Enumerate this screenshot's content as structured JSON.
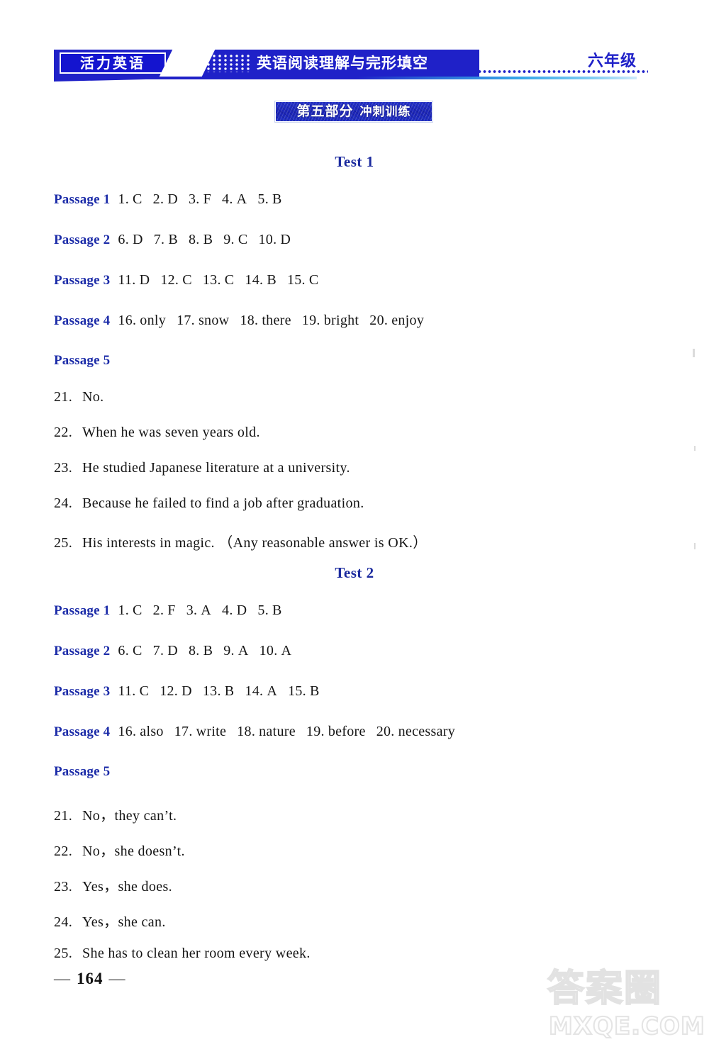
{
  "header": {
    "brand": "活力英语",
    "title": "英语阅读理解与完形填空",
    "grade": "六年级"
  },
  "section": {
    "part_label": "第五部分",
    "part_name": "冲刺训练"
  },
  "footer": {
    "left_dash": "—",
    "page_number": "164",
    "right_dash": "—"
  },
  "watermark": {
    "chinese": "答案圈",
    "domain": "MXQE.COM"
  },
  "tests": [
    {
      "heading": "Test 1",
      "passages": [
        {
          "label": "Passage 1",
          "answers": [
            {
              "num": "1.",
              "val": "C"
            },
            {
              "num": "2.",
              "val": "D"
            },
            {
              "num": "3.",
              "val": "F"
            },
            {
              "num": "4.",
              "val": "A"
            },
            {
              "num": "5.",
              "val": "B"
            }
          ]
        },
        {
          "label": "Passage 2",
          "answers": [
            {
              "num": "6.",
              "val": "D"
            },
            {
              "num": "7.",
              "val": "B"
            },
            {
              "num": "8.",
              "val": "B"
            },
            {
              "num": "9.",
              "val": "C"
            },
            {
              "num": "10.",
              "val": "D"
            }
          ]
        },
        {
          "label": "Passage 3",
          "answers": [
            {
              "num": "11.",
              "val": "D"
            },
            {
              "num": "12.",
              "val": "C"
            },
            {
              "num": "13.",
              "val": "C"
            },
            {
              "num": "14.",
              "val": "B"
            },
            {
              "num": "15.",
              "val": "C"
            }
          ]
        },
        {
          "label": "Passage 4",
          "answers": [
            {
              "num": "16.",
              "val": "only"
            },
            {
              "num": "17.",
              "val": "snow"
            },
            {
              "num": "18.",
              "val": "there"
            },
            {
              "num": "19.",
              "val": "bright"
            },
            {
              "num": "20.",
              "val": "enjoy"
            }
          ]
        },
        {
          "label": "Passage 5",
          "answers": [],
          "qa": [
            {
              "num": "21.",
              "text": "No."
            },
            {
              "num": "22.",
              "text": "When he was seven years old."
            },
            {
              "num": "23.",
              "text": "He studied Japanese literature at a university."
            },
            {
              "num": "24.",
              "text": "Because he failed to find a job after graduation."
            },
            {
              "num": "25.",
              "text": "His interests in magic. （Any reasonable answer is OK.）"
            }
          ]
        }
      ]
    },
    {
      "heading": "Test 2",
      "passages": [
        {
          "label": "Passage 1",
          "answers": [
            {
              "num": "1.",
              "val": "C"
            },
            {
              "num": "2.",
              "val": "F"
            },
            {
              "num": "3.",
              "val": "A"
            },
            {
              "num": "4.",
              "val": "D"
            },
            {
              "num": "5.",
              "val": "B"
            }
          ]
        },
        {
          "label": "Passage 2",
          "answers": [
            {
              "num": "6.",
              "val": "C"
            },
            {
              "num": "7.",
              "val": "D"
            },
            {
              "num": "8.",
              "val": "B"
            },
            {
              "num": "9.",
              "val": "A"
            },
            {
              "num": "10.",
              "val": "A"
            }
          ]
        },
        {
          "label": "Passage 3",
          "answers": [
            {
              "num": "11.",
              "val": "C"
            },
            {
              "num": "12.",
              "val": "D"
            },
            {
              "num": "13.",
              "val": "B"
            },
            {
              "num": "14.",
              "val": "A"
            },
            {
              "num": "15.",
              "val": "B"
            }
          ]
        },
        {
          "label": "Passage 4",
          "answers": [
            {
              "num": "16.",
              "val": "also"
            },
            {
              "num": "17.",
              "val": "write"
            },
            {
              "num": "18.",
              "val": "nature"
            },
            {
              "num": "19.",
              "val": "before"
            },
            {
              "num": "20.",
              "val": "necessary"
            }
          ]
        },
        {
          "label": "Passage 5",
          "answers": [],
          "qa": [
            {
              "num": "21.",
              "text": "No，they can’t."
            },
            {
              "num": "22.",
              "text": "No，she doesn’t."
            },
            {
              "num": "23.",
              "text": "Yes，she does."
            },
            {
              "num": "24.",
              "text": "Yes，she can."
            },
            {
              "num": "25.",
              "text": "She has to clean her room every week."
            }
          ]
        }
      ]
    }
  ]
}
